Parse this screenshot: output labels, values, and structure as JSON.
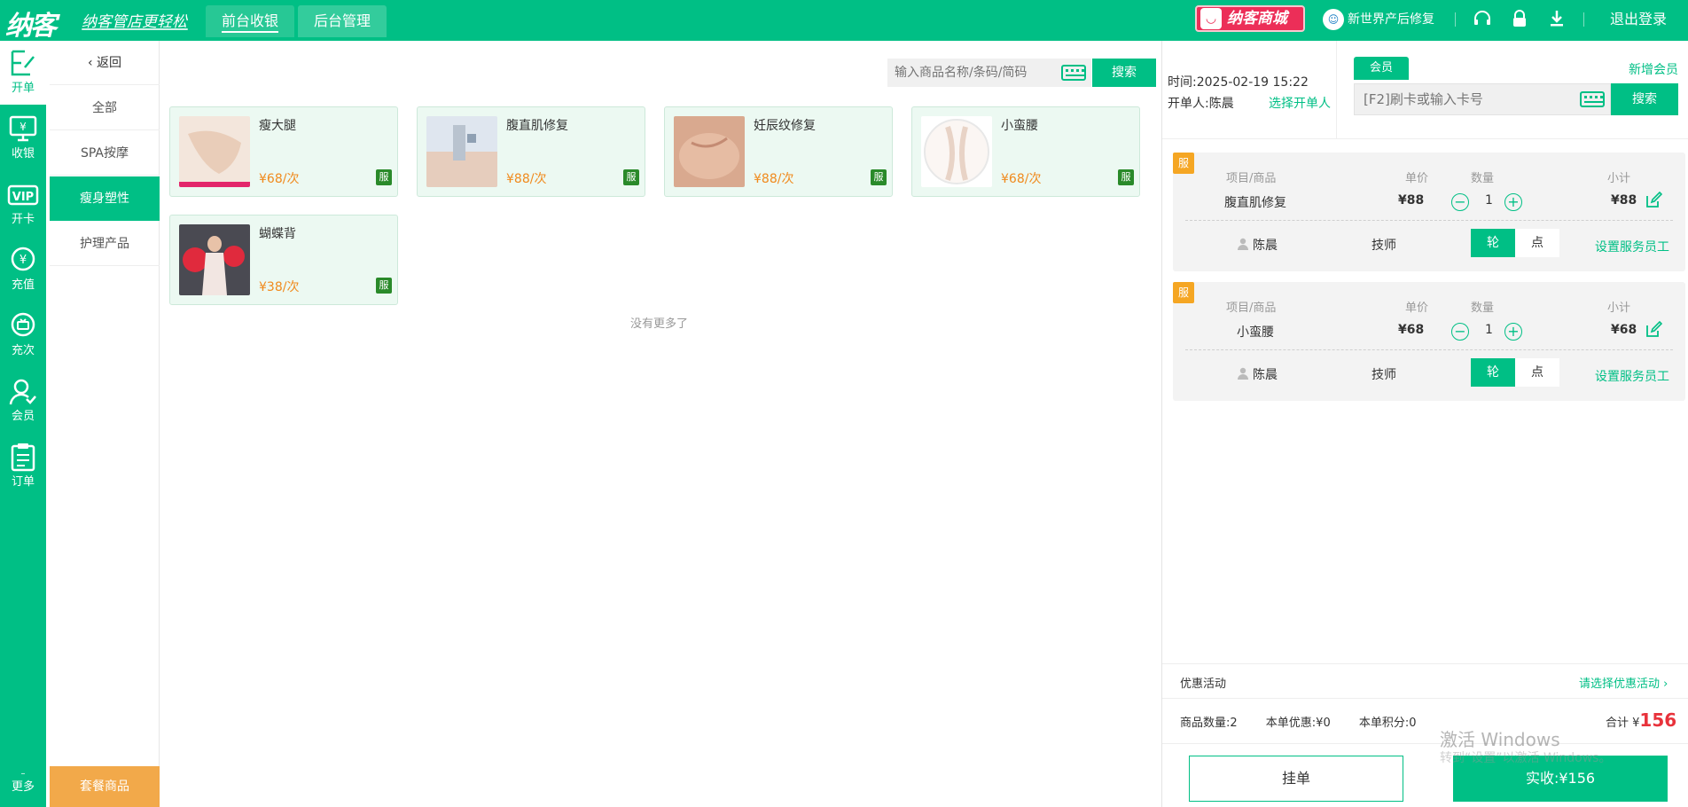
{
  "topbar": {
    "logo": "纳客",
    "slogan": "纳客管店更轻松",
    "tabs": [
      {
        "label": "前台收银",
        "active": true
      },
      {
        "label": "后台管理",
        "active": false
      }
    ],
    "mall": "纳客商城",
    "store": "新世界产后修复",
    "logout": "退出登录",
    "icons": [
      "headset-icon",
      "lock-icon",
      "download-icon"
    ]
  },
  "leftnav": {
    "items": [
      {
        "label": "开单",
        "icon": "open-order-icon",
        "active": true
      },
      {
        "label": "收银",
        "icon": "cashier-icon"
      },
      {
        "label": "开卡",
        "icon": "vip-card-icon",
        "icon_text": "VIP"
      },
      {
        "label": "充值",
        "icon": "recharge-icon",
        "icon_text": "¥"
      },
      {
        "label": "充次",
        "icon": "recharge-times-icon"
      },
      {
        "label": "会员",
        "icon": "member-icon"
      },
      {
        "label": "订单",
        "icon": "order-icon"
      }
    ],
    "more": "更多"
  },
  "categories": {
    "back": "返回",
    "items": [
      "全部",
      "SPA按摩",
      "瘦身塑性",
      "护理产品"
    ],
    "active_index": 2,
    "package": "套餐商品"
  },
  "search": {
    "placeholder": "输入商品名称/条码/简码",
    "button": "搜索"
  },
  "products": [
    {
      "name": "瘦大腿",
      "price": "¥68/次",
      "tag": "服"
    },
    {
      "name": "腹直肌修复",
      "price": "¥88/次",
      "tag": "服"
    },
    {
      "name": "妊辰纹修复",
      "price": "¥88/次",
      "tag": "服"
    },
    {
      "name": "小蛮腰",
      "price": "¥68/次",
      "tag": "服"
    },
    {
      "name": "蝴蝶背",
      "price": "¥38/次",
      "tag": "服"
    }
  ],
  "no_more": "没有更多了",
  "order_info": {
    "time": "时间:2025-02-19 15:22",
    "opener": "开单人:陈晨",
    "choose_opener": "选择开单人",
    "member_tab": "会员",
    "add_member": "新增会员",
    "card_placeholder": "[F2]刷卡或输入卡号",
    "member_search": "搜索"
  },
  "order_headers": {
    "item": "项目/商品",
    "price": "单价",
    "qty": "数量",
    "subtotal": "小计"
  },
  "order_items": [
    {
      "tag": "服",
      "name": "腹直肌修复",
      "price": "¥88",
      "qty": "1",
      "subtotal": "¥88",
      "staff": "陈晨",
      "role": "技师",
      "seg_a": "轮",
      "seg_b": "点",
      "set_staff": "设置服务员工"
    },
    {
      "tag": "服",
      "name": "小蛮腰",
      "price": "¥68",
      "qty": "1",
      "subtotal": "¥68",
      "staff": "陈晨",
      "role": "技师",
      "seg_a": "轮",
      "seg_b": "点",
      "set_staff": "设置服务员工"
    }
  ],
  "discount": {
    "label": "优惠活动",
    "choose": "请选择优惠活动"
  },
  "summary": {
    "count": "商品数量:2",
    "discount": "本单优惠:¥0",
    "points": "本单积分:0",
    "total_label": "合计 ¥",
    "total_value": "156"
  },
  "actions": {
    "hang": "挂单",
    "pay": "实收:¥156"
  },
  "watermark": {
    "line1": "激活 Windows",
    "line2": "转到“设置”以激活 Windows。"
  }
}
